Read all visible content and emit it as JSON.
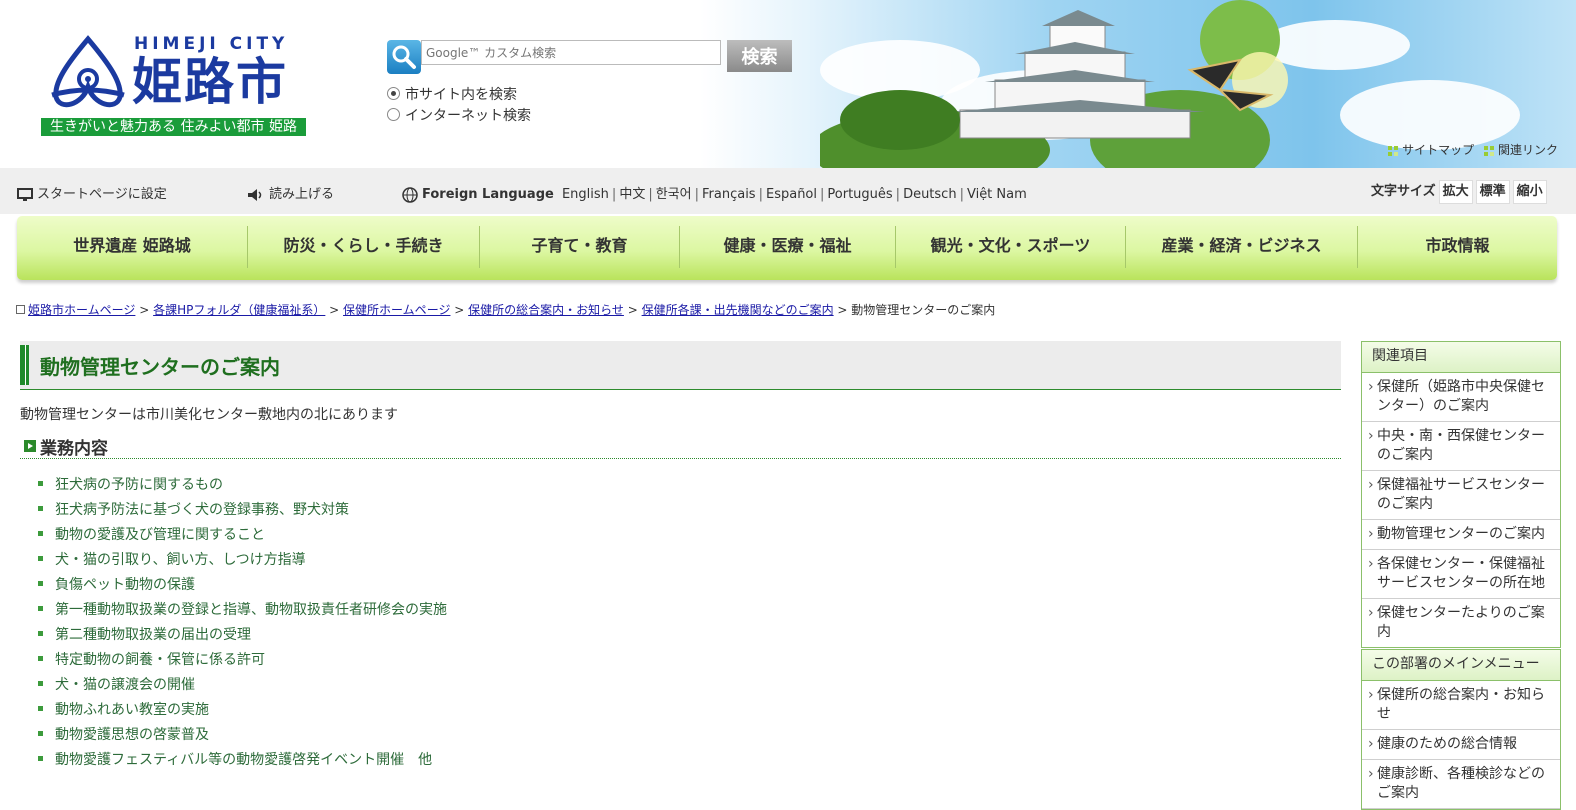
{
  "header": {
    "logo_en": "HIMEJI CITY",
    "logo_ja": "姫路市",
    "slogan": "生きがいと魅力ある 住みよい都市 姫路",
    "search_placeholder": "Google™ カスタム検索",
    "search_button": "検索",
    "radio_site": "市サイト内を検索",
    "radio_web": "インターネット検索",
    "sitemap": "サイトマップ",
    "related_links": "関連リンク"
  },
  "toolbar": {
    "start_page": "スタートページに設定",
    "read_aloud": "読み上げる",
    "foreign_language": "Foreign Language",
    "languages": [
      "English",
      "中文",
      "한국어",
      "Français",
      "Español",
      "Português",
      "Deutsch",
      "Việt Nam"
    ],
    "font_size_label": "文字サイズ",
    "font_larger": "拡大",
    "font_standard": "標準",
    "font_smaller": "縮小"
  },
  "gnav": [
    "世界遺産 姫路城",
    "防災・くらし・手続き",
    "子育て・教育",
    "健康・医療・福祉",
    "観光・文化・スポーツ",
    "産業・経済・ビジネス",
    "市政情報"
  ],
  "breadcrumb": {
    "links": [
      "姫路市ホームページ",
      "各課HPフォルダ（健康福祉系）",
      "保健所ホームページ",
      "保健所の総合案内・お知らせ",
      "保健所各課・出先機関などのご案内"
    ],
    "current": "動物管理センターのご案内"
  },
  "main": {
    "title": "動物管理センターのご案内",
    "intro": "動物管理センターは市川美化センター敷地内の北にあります",
    "section_title": "業務内容",
    "duties": [
      "狂犬病の予防に関するもの",
      "狂犬病予防法に基づく犬の登録事務、野犬対策",
      "動物の愛護及び管理に関すること",
      "犬・猫の引取り、飼い方、しつけ方指導",
      "負傷ペット動物の保護",
      "第一種動物取扱業の登録と指導、動物取扱責任者研修会の実施",
      "第二種動物取扱業の届出の受理",
      "特定動物の飼養・保管に係る許可",
      "犬・猫の譲渡会の開催",
      "動物ふれあい教室の実施",
      "動物愛護思想の啓蒙普及",
      "動物愛護フェスティバル等の動物愛護啓発イベント開催　他"
    ]
  },
  "sidebar": {
    "related_title": "関連項目",
    "related_items": [
      "保健所（姫路市中央保健センター）のご案内",
      "中央・南・西保健センターのご案内",
      "保健福祉サービスセンターのご案内",
      "動物管理センターのご案内",
      "各保健センター・保健福祉サービスセンターの所在地",
      "保健センターたよりのご案内"
    ],
    "menu_title": "この部署のメインメニュー",
    "menu_items": [
      "保健所の総合案内・お知らせ",
      "健康のための総合情報",
      "健康診断、各種検診などのご案内"
    ]
  },
  "colors": {
    "brand_blue": "#1b3aa0",
    "brand_green": "#1a9c3a",
    "nav_green": "#b9e35b",
    "title_green": "#1f6f1f"
  }
}
